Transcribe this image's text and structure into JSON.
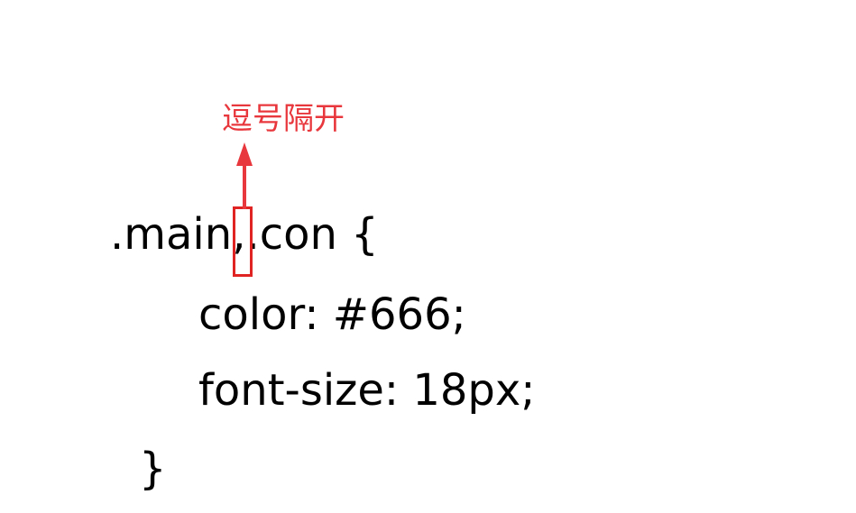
{
  "annotation": {
    "text": "逗号隔开",
    "color": "#e8383d"
  },
  "code": {
    "selector_part1": ".main",
    "comma": ",",
    "selector_part2": ".con {",
    "line2": "color: #666;",
    "line3": "font-size: 18px;",
    "line4": "}"
  },
  "colors": {
    "text": "#000000",
    "highlight": "#e02424",
    "arrow": "#e8383d"
  }
}
